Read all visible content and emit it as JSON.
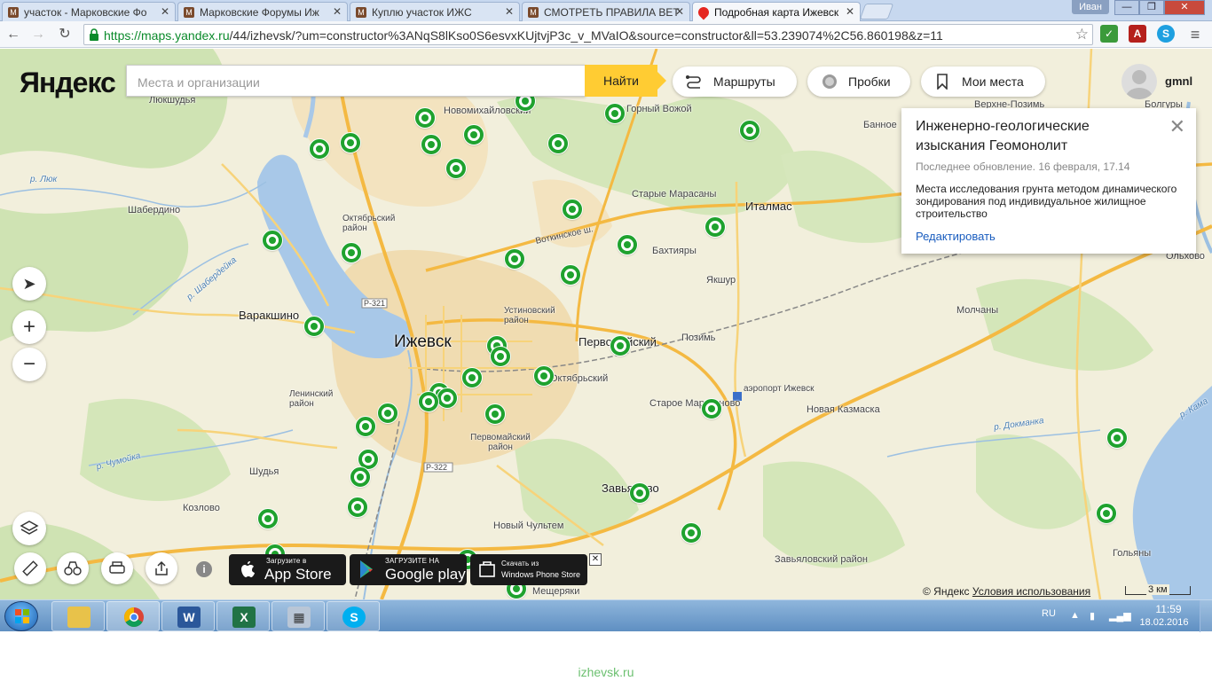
{
  "tabs": [
    {
      "title": "участок - Марковские Фо",
      "active": false
    },
    {
      "title": "Марковские Форумы Иж",
      "active": false
    },
    {
      "title": "Куплю участок ИЖС",
      "active": false
    },
    {
      "title": "СМОТРЕТЬ ПРАВИЛА ВЕТ",
      "active": false
    },
    {
      "title": "Подробная карта Ижевск",
      "active": true
    }
  ],
  "window": {
    "user": "Иван",
    "minimize": "—",
    "maximize": "❐",
    "close": "✕"
  },
  "address": {
    "scheme_host": "https://maps.yandex.ru",
    "path": "/44/izhevsk/?um=constructor%3ANqS8lKso0S6esvxKUjtvjP3c_v_MVaIO&source=constructor&ll=53.239074%2C56.860198&z=11"
  },
  "maps": {
    "logo": "Яндекс",
    "search_placeholder": "Места и организации",
    "find_label": "Найти",
    "routes_label": "Маршруты",
    "traffic_label": "Пробки",
    "my_places_label": "Мои места",
    "username": "gmnl"
  },
  "info_card": {
    "title": "Инженерно-геологические изыскания Геомонолит",
    "updated": "Последнее обновление. 16 февраля, 17.14",
    "description": "Места исследования грунта методом динамического зондирования под индивидуальное жилищное строительство",
    "edit_label": "Редактировать"
  },
  "places": [
    {
      "text": "Ижевск",
      "cls": "city"
    },
    {
      "text": "Италмас",
      "cls": "big"
    },
    {
      "text": "Варакшино",
      "cls": "big"
    },
    {
      "text": "Первомайский",
      "cls": "big"
    },
    {
      "text": "Завьялово",
      "cls": "big"
    },
    {
      "text": "Люкшудья",
      "cls": ""
    },
    {
      "text": "Новомихайловский",
      "cls": ""
    },
    {
      "text": "Горный Вожой",
      "cls": ""
    },
    {
      "text": "Банное",
      "cls": ""
    },
    {
      "text": "Верхне-Позимь",
      "cls": ""
    },
    {
      "text": "Болгуры",
      "cls": ""
    },
    {
      "text": "Старые Марасаны",
      "cls": ""
    },
    {
      "text": "Шабердино",
      "cls": ""
    },
    {
      "text": "Октябрьский район",
      "cls": ""
    },
    {
      "text": "Бахтияры",
      "cls": ""
    },
    {
      "text": "Якшур",
      "cls": ""
    },
    {
      "text": "Устиновский район",
      "cls": ""
    },
    {
      "text": "Позимь",
      "cls": ""
    },
    {
      "text": "Молчаны",
      "cls": ""
    },
    {
      "text": "Ольхово",
      "cls": ""
    },
    {
      "text": "Ленинский район",
      "cls": ""
    },
    {
      "text": "Октябрьский",
      "cls": ""
    },
    {
      "text": "Старое Мартьяново",
      "cls": ""
    },
    {
      "text": "аэропорт Ижевск",
      "cls": ""
    },
    {
      "text": "Новая Казмаска",
      "cls": ""
    },
    {
      "text": "Первомайский район",
      "cls": ""
    },
    {
      "text": "Шудья",
      "cls": ""
    },
    {
      "text": "Козлово",
      "cls": ""
    },
    {
      "text": "Новый Чультем",
      "cls": ""
    },
    {
      "text": "Мещеряки",
      "cls": ""
    },
    {
      "text": "Завьяловский район",
      "cls": ""
    },
    {
      "text": "Гольяны",
      "cls": ""
    },
    {
      "text": "Р-321",
      "cls": ""
    },
    {
      "text": "Р-322",
      "cls": ""
    },
    {
      "text": "р. Люк",
      "cls": "river"
    },
    {
      "text": "р. Шабердейка",
      "cls": "river"
    },
    {
      "text": "р. Чумойка",
      "cls": "river"
    },
    {
      "text": "р. Докманка",
      "cls": "river"
    },
    {
      "text": "р. Кама",
      "cls": "river"
    },
    {
      "text": "Воткинское ш.",
      "cls": ""
    }
  ],
  "map_controls": {
    "locate": "➤",
    "zoom_in": "+",
    "zoom_out": "−",
    "info": "i"
  },
  "badges": {
    "appstore_small": "Загрузите в",
    "appstore_large": "App Store",
    "google_small": "ЗАГРУЗИТЕ НА",
    "google_large": "Google play",
    "windows_small": "Скачать из",
    "windows_large": "Windows Phone Store",
    "close": "✕"
  },
  "footer": {
    "copyright": "© Яндекс",
    "terms": "Условия использования",
    "scale": "3 км"
  },
  "taskbar": {
    "lang": "RU",
    "time": "11:59",
    "date": "18.02.2016"
  },
  "watermark": "izhevsk.ru",
  "colors": {
    "marker": "#1fa22e",
    "find_button": "#ffcc33",
    "link": "#1a5dbf"
  }
}
